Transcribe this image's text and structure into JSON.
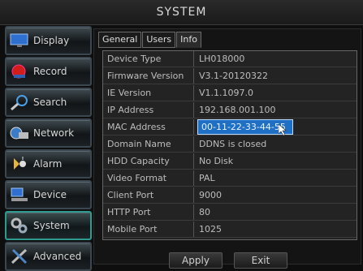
{
  "header": {
    "title": "SYSTEM"
  },
  "sidebar": {
    "items": [
      {
        "label": "Display",
        "icon": "monitor-icon"
      },
      {
        "label": "Record",
        "icon": "record-icon"
      },
      {
        "label": "Search",
        "icon": "search-icon"
      },
      {
        "label": "Network",
        "icon": "network-icon"
      },
      {
        "label": "Alarm",
        "icon": "alarm-icon"
      },
      {
        "label": "Device",
        "icon": "device-icon"
      },
      {
        "label": "System",
        "icon": "system-icon",
        "active": true
      },
      {
        "label": "Advanced",
        "icon": "tools-icon"
      }
    ]
  },
  "tabs": {
    "general": "General",
    "users": "Users",
    "info": "Info",
    "active": "Info"
  },
  "info": {
    "rows": [
      {
        "key": "Device Type",
        "value": "LH018000"
      },
      {
        "key": "Firmware Version",
        "value": "V3.1-20120322"
      },
      {
        "key": "IE Version",
        "value": "V1.1.1097.0"
      },
      {
        "key": "IP Address",
        "value": "192.168.001.100"
      },
      {
        "key": "MAC Address",
        "value": "00-11-22-33-44-55"
      },
      {
        "key": "Domain Name",
        "value": "DDNS is closed"
      },
      {
        "key": "HDD Capacity",
        "value": "No Disk"
      },
      {
        "key": "Video Format",
        "value": "PAL"
      },
      {
        "key": "Client Port",
        "value": "9000"
      },
      {
        "key": "HTTP Port",
        "value": "80"
      },
      {
        "key": "Mobile Port",
        "value": "1025"
      }
    ]
  },
  "buttons": {
    "apply": "Apply",
    "exit": "Exit"
  },
  "colors": {
    "selection": "#1f6fc4",
    "active_border": "#2f9a90"
  }
}
